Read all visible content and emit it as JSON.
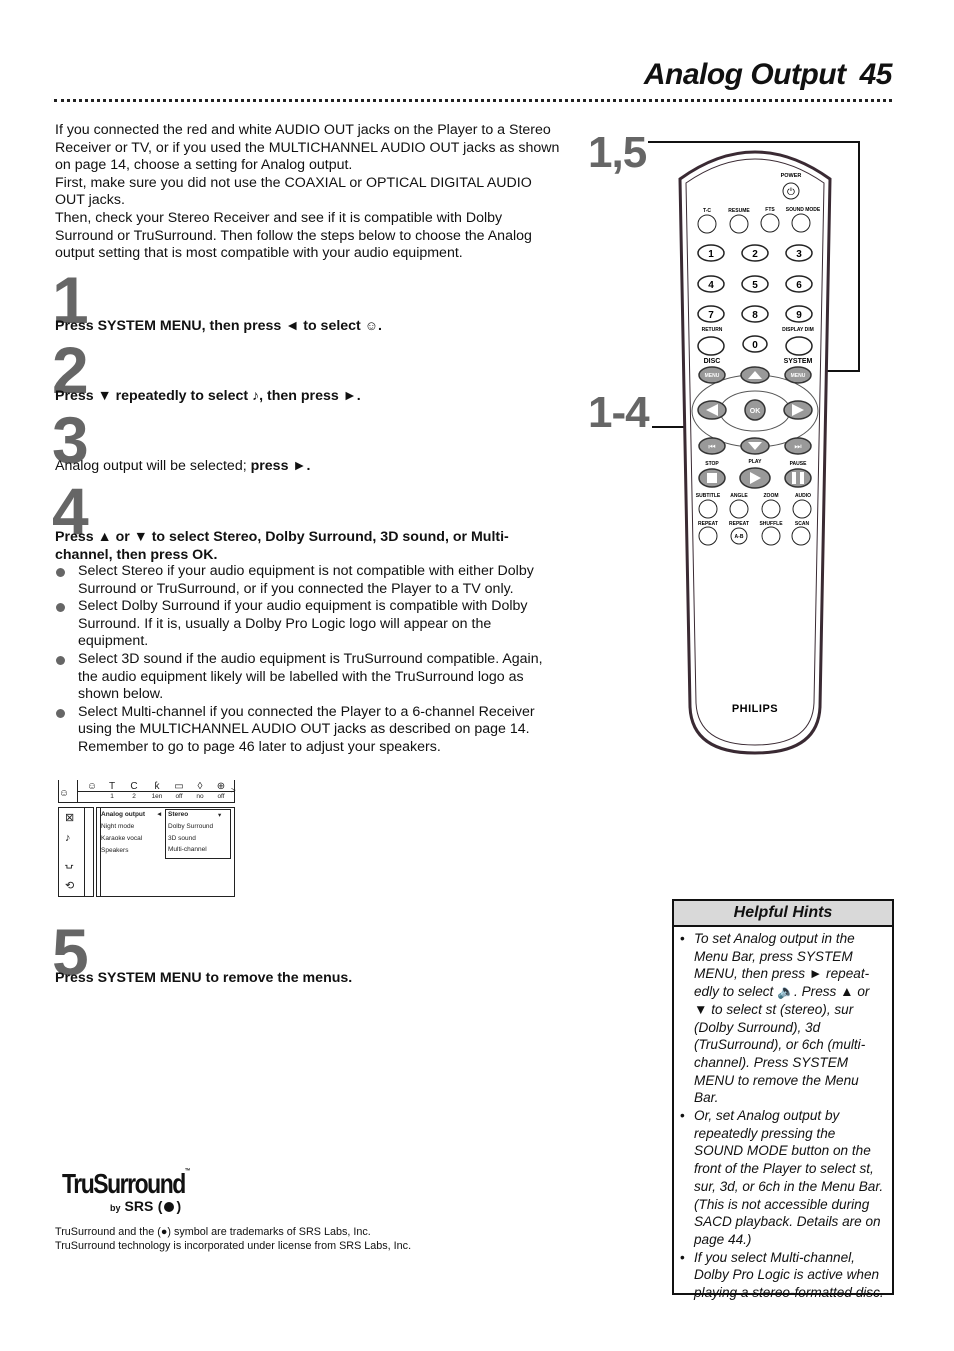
{
  "header": {
    "title": "Analog Output",
    "page_number": "45"
  },
  "intro": {
    "paragraphs": [
      "If you connected the red and white AUDIO OUT jacks on the Player to a Stereo Receiver or TV, or if you used the MULTICHANNEL AUDIO OUT jacks as shown on page 14, choose a setting for Analog output.",
      "First, make sure you did not use the COAXIAL or OPTICAL DIGITAL AUDIO OUT jacks.",
      "Then, check your Stereo Receiver and see if it is compatible with Dolby Surround or TruSurround. Then follow the steps below to choose the Analog output setting that is most compatible with your audio equipment."
    ]
  },
  "steps": [
    {
      "number": "1",
      "parts": [
        {
          "b": "Press SYSTEM MENU, then press "
        },
        {
          "b": "◄"
        },
        {
          "b": " to select "
        },
        {
          "icon": "setup-icon",
          "glyph": "☺"
        },
        {
          "b": "."
        }
      ]
    },
    {
      "number": "2",
      "parts": [
        {
          "b": "Press ▼ repeatedly to select "
        },
        {
          "icon": "audio-note-icon",
          "glyph": "♪"
        },
        {
          "b": ", then press ►."
        }
      ]
    },
    {
      "number": "3",
      "parts": [
        {
          "t": "Analog output will be selected; "
        },
        {
          "b": "press ►."
        }
      ]
    },
    {
      "number": "4",
      "parts": [
        {
          "b": "Press ▲ or ▼ to select Stereo, Dolby Surround, 3D sound, or Multi-channel, then press OK."
        }
      ]
    },
    {
      "number": "5",
      "parts": [
        {
          "b": "Press SYSTEM MENU to remove the menus."
        }
      ]
    }
  ],
  "step4_bullets": [
    "Select Stereo if your audio equipment is not compatible with either Dolby Surround or TruSurround, or if you connected the Player to a TV only.",
    "Select Dolby Surround if your audio equipment is compatible with Dolby Surround. If it is, usually a Dolby Pro Logic logo will appear on the equipment.",
    "Select 3D sound if the audio equipment is TruSurround compatible. Again, the audio equipment likely will be labelled with the TruSurround logo as shown below.",
    "Select Multi-channel if you connected the Player to a 6-channel Receiver using the MULTICHANNEL AUDIO OUT jacks as described on page 14. Remember to go to page 46 later to adjust your speakers."
  ],
  "osd_menu": {
    "menu_bar": [
      {
        "icon": "setup-icon",
        "glyph": "☺",
        "value": ""
      },
      {
        "icon": "title-icon",
        "glyph": "T",
        "value": "1"
      },
      {
        "icon": "chapter-icon",
        "glyph": "C",
        "value": "2"
      },
      {
        "icon": "audio-lang-icon",
        "glyph": "ƙ",
        "value": "1en"
      },
      {
        "icon": "subtitle-icon",
        "glyph": "▭",
        "value": "off"
      },
      {
        "icon": "sound-icon",
        "glyph": "◊",
        "value": "no"
      },
      {
        "icon": "zoom-icon",
        "glyph": "⊕",
        "value": "off"
      }
    ],
    "more_arrow": ">",
    "left_icons": [
      "picture-icon",
      "audio-note-icon",
      "language-icon",
      "features-icon"
    ],
    "left_glyphs": [
      "⊠",
      "♪",
      "⍽",
      "⟲"
    ],
    "options": [
      "Analog output",
      "Night mode",
      "Karaoke vocal",
      "Speakers"
    ],
    "selected_option": "Analog output",
    "selector_arrow": "◄",
    "submenu_options": [
      "Stereo",
      "Dolby Surround",
      "3D sound",
      "Multi-channel"
    ],
    "submenu_selected": "Stereo",
    "submenu_arrow": "▾"
  },
  "trademark": {
    "logo_text": "TruSurround",
    "logo_tm": "™",
    "by": "by",
    "srs": "SRS",
    "lines": [
      "TruSurround and the (●) symbol are trademarks of SRS Labs, Inc.",
      "TruSurround technology is incorporated under license from SRS Labs, Inc."
    ]
  },
  "remote": {
    "callout_top": "1,5",
    "callout_mid": "1-4",
    "brand": "PHILIPS",
    "power_label": "POWER",
    "top_row": [
      "T-C",
      "RESUME",
      "FTS",
      "SOUND MODE"
    ],
    "digits": [
      "1",
      "2",
      "3",
      "4",
      "5",
      "6",
      "7",
      "8",
      "9",
      "0"
    ],
    "return_label": "RETURN",
    "display_dim_label": "DISPLAY DIM",
    "disc_label": "DISC",
    "system_label": "SYSTEM",
    "menu_label": "MENU",
    "ok_label": "OK",
    "transport_labels": [
      "STOP",
      "PLAY",
      "PAUSE"
    ],
    "row_a": [
      "SUBTITLE",
      "ANGLE",
      "ZOOM",
      "AUDIO"
    ],
    "row_b": [
      "REPEAT",
      "REPEAT",
      "SHUFFLE",
      "SCAN"
    ],
    "ab_label": "A-B"
  },
  "hints": {
    "title": "Helpful Hints",
    "items": [
      "To set Analog output in the Menu Bar, press SYSTEM MENU, then press ► repeat-edly to select 🔈. Press ▲ or ▼ to select st (stereo), sur (Dolby Surround), 3d (TruSurround), or 6ch (multi-channel). Press SYSTEM MENU to remove the Menu Bar.",
      "Or, set Analog output by repeatedly pressing the SOUND MODE button on the front of the Player to select st, sur, 3d, or 6ch in the Menu Bar. (This is not accessible during SACD playback. Details are on page 44.)",
      "If you select Multi-channel, Dolby Pro Logic is active when playing a stereo-formatted disc."
    ]
  }
}
